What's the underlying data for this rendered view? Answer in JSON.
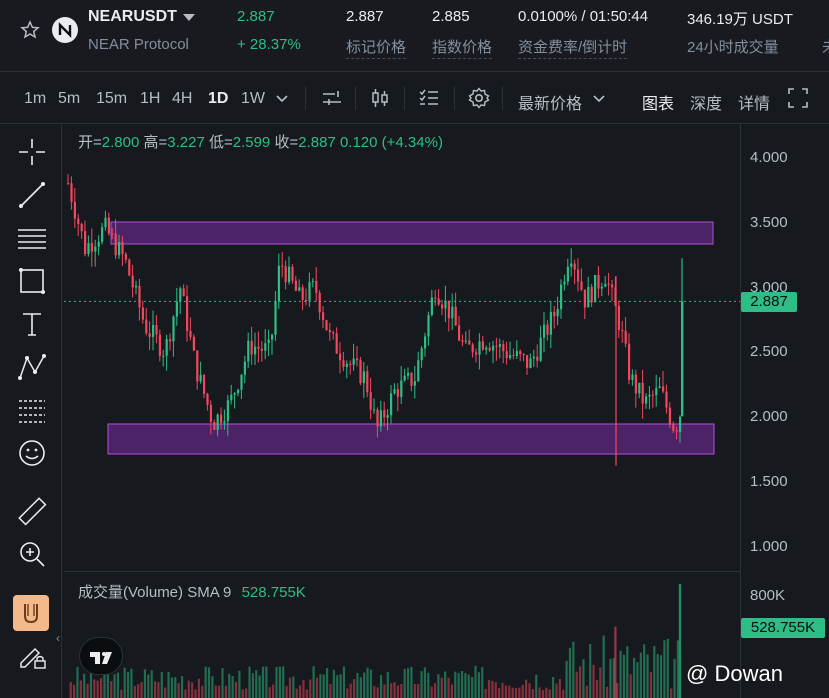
{
  "header": {
    "symbol": "NEARUSDT",
    "name": "NEAR Protocol",
    "last_price": "2.887",
    "change_pct": "+ 28.37%",
    "mark_price": "2.887",
    "mark_label": "标记价格",
    "index_price": "2.885",
    "index_label": "指数价格",
    "funding": "0.0100% / 01:50:44",
    "funding_label": "资金费率/倒计时",
    "volume_24h": "346.19万 USDT",
    "volume_label": "24小时成交量",
    "more_label": "未"
  },
  "toolbar": {
    "timeframes": [
      "1m",
      "5m",
      "15m",
      "1H",
      "4H",
      "1D",
      "1W"
    ],
    "active_timeframe": "1D",
    "price_type": "最新价格",
    "view_chart": "图表",
    "view_depth": "深度",
    "view_details": "详情"
  },
  "ohlc": {
    "open_label": "开=",
    "open": "2.800",
    "high_label": "高=",
    "high": "3.227",
    "low_label": "低=",
    "low": "2.599",
    "close_label": "收=",
    "close": "2.887",
    "change": "0.120",
    "change_pct": "(+4.34%)"
  },
  "price_axis": [
    "4.000",
    "3.500",
    "3.000",
    "2.500",
    "2.000",
    "1.500",
    "1.000"
  ],
  "current_price_tag": "2.887",
  "volume": {
    "title": "成交量(Volume)",
    "sma_label": "SMA 9",
    "sma_value": "528.755K",
    "axis_top": "800K",
    "tag": "528.755K"
  },
  "watermark": "@ Dowan",
  "colors": {
    "up": "#2ebd85",
    "down": "#f6465d",
    "zone": "#8e2fbf",
    "bg": "#161a1e"
  },
  "icons": [
    "star-icon",
    "near-logo-icon",
    "chevron-down-icon",
    "crosshair-icon",
    "trendline-icon",
    "horizontal-lines-icon",
    "rectangle-icon",
    "text-icon",
    "pattern-icon",
    "fib-icon",
    "emoji-icon",
    "ruler-icon",
    "zoom-in-icon",
    "lock-draw-icon",
    "settings-icon",
    "fullscreen-icon",
    "candle-type-icon",
    "indicators-icon"
  ]
}
